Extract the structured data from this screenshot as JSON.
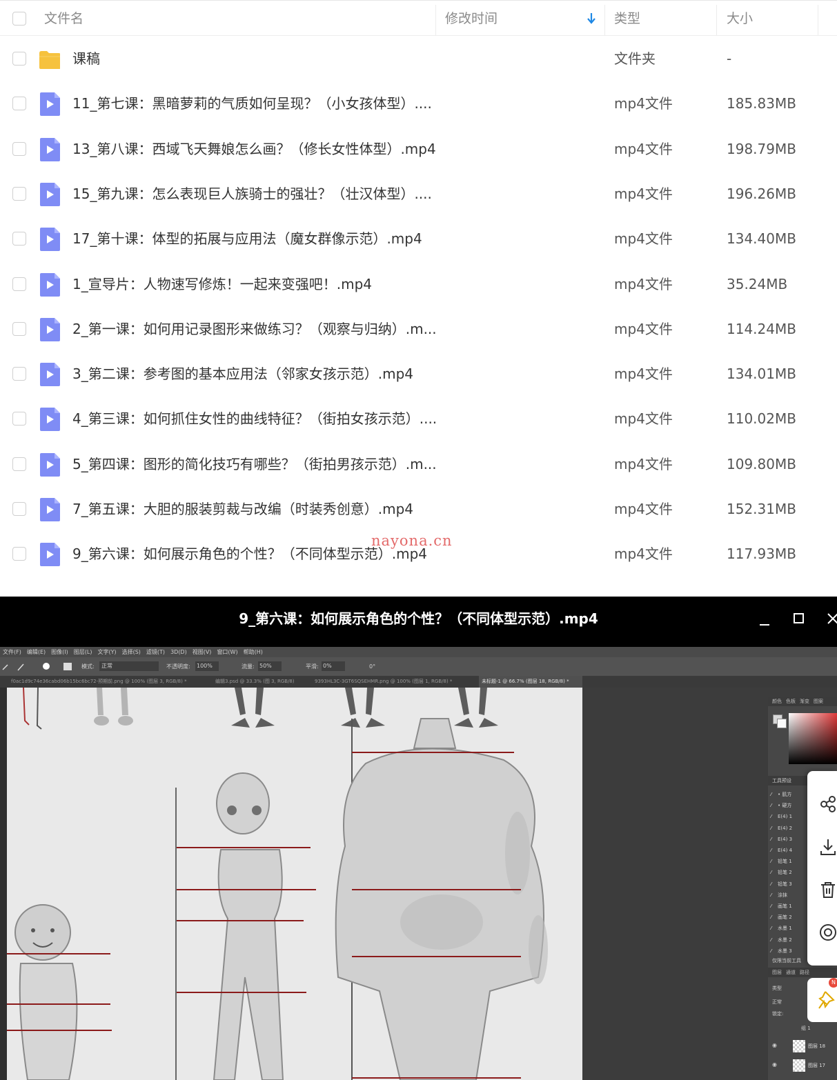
{
  "header": {
    "name_label": "文件名",
    "modified_label": "修改时间",
    "type_label": "类型",
    "size_label": "大小"
  },
  "files": [
    {
      "icon": "folder-icon",
      "name": "课稿",
      "type": "文件夹",
      "size": "-"
    },
    {
      "icon": "video-file-icon",
      "name": "11_第七课：黑暗萝莉的气质如何呈现？（小女孩体型）....",
      "type": "mp4文件",
      "size": "185.83MB"
    },
    {
      "icon": "video-file-icon",
      "name": "13_第八课：西域飞天舞娘怎么画？（修长女性体型）.mp4",
      "type": "mp4文件",
      "size": "198.79MB"
    },
    {
      "icon": "video-file-icon",
      "name": "15_第九课：怎么表现巨人族骑士的强壮？（壮汉体型）....",
      "type": "mp4文件",
      "size": "196.26MB"
    },
    {
      "icon": "video-file-icon",
      "name": "17_第十课：体型的拓展与应用法（魔女群像示范）.mp4",
      "type": "mp4文件",
      "size": "134.40MB"
    },
    {
      "icon": "video-file-icon",
      "name": "1_宣导片：人物速写修炼！一起来变强吧！.mp4",
      "type": "mp4文件",
      "size": "35.24MB"
    },
    {
      "icon": "video-file-icon",
      "name": "2_第一课：如何用记录图形来做练习？（观察与归纳）.m...",
      "type": "mp4文件",
      "size": "114.24MB"
    },
    {
      "icon": "video-file-icon",
      "name": "3_第二课：参考图的基本应用法（邻家女孩示范）.mp4",
      "type": "mp4文件",
      "size": "134.01MB"
    },
    {
      "icon": "video-file-icon",
      "name": "4_第三课：如何抓住女性的曲线特征？（街拍女孩示范）....",
      "type": "mp4文件",
      "size": "110.02MB"
    },
    {
      "icon": "video-file-icon",
      "name": "5_第四课：图形的简化技巧有哪些？（街拍男孩示范）.m...",
      "type": "mp4文件",
      "size": "109.80MB"
    },
    {
      "icon": "video-file-icon",
      "name": "7_第五课：大胆的服装剪裁与改编（时装秀创意）.mp4",
      "type": "mp4文件",
      "size": "152.31MB"
    },
    {
      "icon": "video-file-icon",
      "name": "9_第六课：如何展示角色的个性？（不同体型示范）.mp4",
      "type": "mp4文件",
      "size": "117.93MB"
    }
  ],
  "watermark": "nayona.cn",
  "player": {
    "title": "9_第六课：如何展示角色的个性？（不同体型示范）.mp4",
    "minimize_icon": "minimize-icon",
    "maximize_icon": "maximize-icon",
    "close_icon": "close-icon"
  },
  "photoshop": {
    "menus": [
      "文件(F)",
      "编辑(E)",
      "图像(I)",
      "图层(L)",
      "文字(Y)",
      "选择(S)",
      "滤镜(T)",
      "3D(D)",
      "视图(V)",
      "窗口(W)",
      "帮助(H)"
    ],
    "options": {
      "mode_label": "模式:",
      "mode_value": "正常",
      "opacity_label": "不透明度:",
      "opacity_value": "100%",
      "flow_label": "流量:",
      "flow_value": "50%",
      "smooth_label": "平滑:",
      "smooth_value": "0%",
      "angle_value": "0°"
    },
    "tabs": [
      "f0ac1d9c74e36cabd06b15bc6bc72-预期前.png @ 100% (图层 3, RGB/8) *",
      "编辑3.psd @ 33.3% (图 3, RGB/8)",
      "9393HL3C-3GT6SQSEHMR.png @ 100% (图层 1, RGB/8) *",
      "未标题-1 @ 66.7% (图层 18, RGB/8) *"
    ],
    "panel_tabs": [
      "颜色",
      "色板",
      "渐变",
      "图案"
    ],
    "presets_title": "工具预设",
    "presets": [
      "• 肌方",
      "• 硬方",
      "E(4) 1",
      "E(4) 2",
      "E(4) 3",
      "E(4) 4",
      "铅笔 1",
      "铅笔 2",
      "铅笔 3",
      "涂抹",
      "画笔 1",
      "画笔 2",
      "水墨 1",
      "水墨 2",
      "水墨 3"
    ],
    "presets_footer": "仅限当前工具",
    "layers_tabs": [
      "图层",
      "通道",
      "路径"
    ],
    "layer_mode": "正常",
    "layer_filter": "类型",
    "layer_lock": "锁定:",
    "group_name": "组 1",
    "layers": [
      "图层 18",
      "图层 17"
    ]
  },
  "share_bar": {
    "icons": [
      "share-icon",
      "download-icon",
      "delete-icon",
      "view-icon",
      "pin-icon"
    ],
    "badge": "N"
  }
}
